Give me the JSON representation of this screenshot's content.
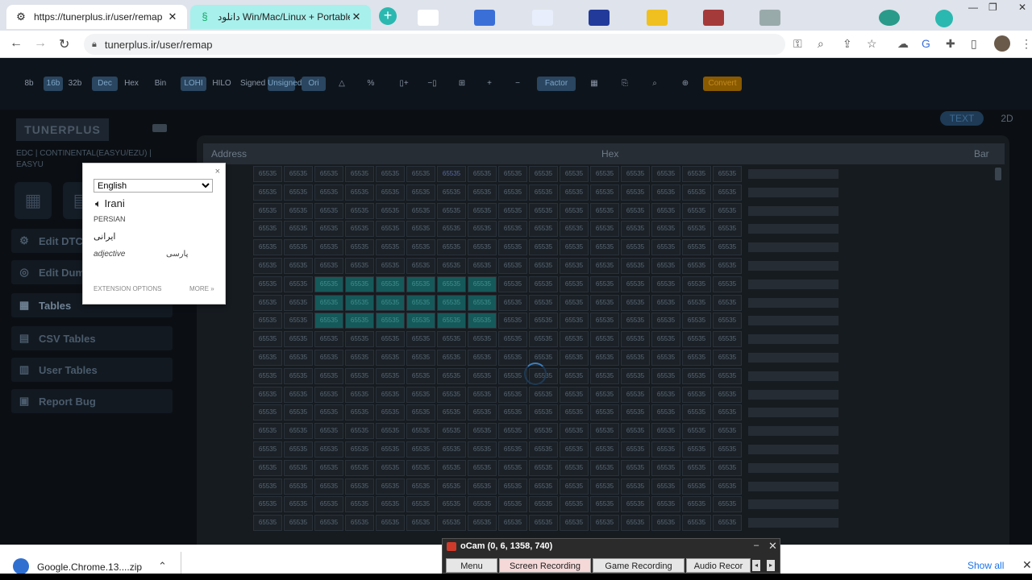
{
  "browser": {
    "tabs": [
      {
        "title": "https://tunerplus.ir/user/remap",
        "icon": "gear-icon",
        "close": "✕"
      },
      {
        "title": "دانلود Win/Mac/Linux + Portable ...",
        "icon": "site-icon",
        "close": "✕"
      }
    ],
    "new_tab": "+",
    "url": "tunerplus.ir/user/remap",
    "controls": {
      "min": "—",
      "max": "❐",
      "close": "✕"
    }
  },
  "toolbar": {
    "items": [
      {
        "label": "8b",
        "on": false
      },
      {
        "label": "16b",
        "on": true
      },
      {
        "label": "32b",
        "on": false
      },
      {
        "label": "Dec",
        "on": true
      },
      {
        "label": "Hex",
        "on": false
      },
      {
        "label": "Bin",
        "on": false
      },
      {
        "label": "LOHI",
        "on": true
      },
      {
        "label": "HILO",
        "on": false
      },
      {
        "label": "Signed",
        "on": false
      },
      {
        "label": "Unsigned",
        "on": true
      },
      {
        "label": "Ori",
        "on": true
      },
      {
        "label": "△",
        "on": false
      },
      {
        "label": "%",
        "on": false
      },
      {
        "label": "▯+",
        "on": false
      },
      {
        "label": "−▯",
        "on": false
      },
      {
        "label": "⊞",
        "on": false
      },
      {
        "label": "+",
        "on": false
      },
      {
        "label": "−",
        "on": false
      },
      {
        "label": "Factor",
        "on": true
      },
      {
        "label": "▦",
        "on": false
      },
      {
        "label": "⎘",
        "on": false
      },
      {
        "label": "⌕",
        "on": false
      },
      {
        "label": "⊕",
        "on": false
      },
      {
        "label": "Convert",
        "on": false
      }
    ]
  },
  "sidebar": {
    "logo": "TUNERPLUS",
    "ecu": "EDC | CONTINENTAL(EASYU/EZU) | EASYU",
    "menu": [
      {
        "label": "Edit DTC",
        "icon": "engine-icon"
      },
      {
        "label": "Edit Dum",
        "icon": "chip-icon"
      },
      {
        "label": "Tables",
        "icon": "table-icon"
      },
      {
        "label": "CSV Tables",
        "icon": "csv-icon"
      },
      {
        "label": "User Tables",
        "icon": "user-table-icon"
      },
      {
        "label": "Report Bug",
        "icon": "bug-icon"
      }
    ]
  },
  "view": {
    "text": "TEXT",
    "twod": "2D"
  },
  "hex": {
    "col_address": "Address",
    "col_hex": "Hex",
    "col_bar": "Bar",
    "cell_value": "65535",
    "rows": 20,
    "cols": 16
  },
  "popup": {
    "language": "English",
    "word": "Irani",
    "lang_name": "PERSIAN",
    "translation": "ایرانی",
    "part_of_speech": "adjective",
    "alt": "پارسی",
    "options": "EXTENSION OPTIONS",
    "more": "MORE »",
    "close": "×"
  },
  "downloads": {
    "file": "Google.Chrome.13....zip",
    "show_all": "Show all",
    "close": "✕"
  },
  "ocam": {
    "title": "oCam (0, 6, 1358, 740)",
    "tabs": [
      "Menu",
      "Screen Recording",
      "Game Recording",
      "Audio Recor"
    ],
    "min": "–",
    "close": "✕"
  }
}
